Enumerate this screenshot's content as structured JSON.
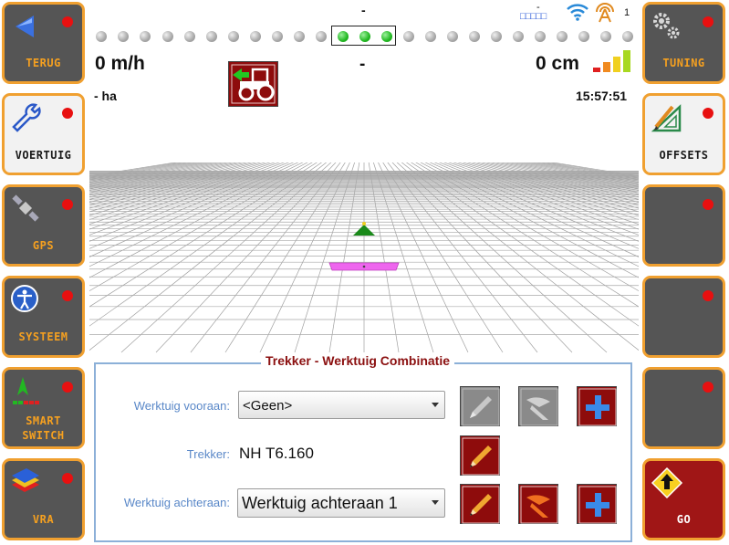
{
  "left_buttons": [
    {
      "label": "TERUG",
      "icon": "back-arrow-icon"
    },
    {
      "label": "VOERTUIG",
      "icon": "wrench-icon"
    },
    {
      "label": "GPS",
      "icon": "satellite-icon"
    },
    {
      "label": "SYSTEEM",
      "icon": "accessibility-icon"
    },
    {
      "label_line1": "SMART",
      "label_line2": "SWITCH",
      "icon": "smart-switch-icon"
    },
    {
      "label": "VRA",
      "icon": "vra-layers-icon"
    }
  ],
  "right_buttons": [
    {
      "label": "TUNING",
      "icon": "gears-icon"
    },
    {
      "label": "OFFSETS",
      "icon": "pencil-triangle-icon"
    },
    {
      "label": ""
    },
    {
      "label": ""
    },
    {
      "label": ""
    },
    {
      "label": "GO",
      "icon": "go-arrow-icon"
    }
  ],
  "status_bar": {
    "top_dash": "-",
    "speed": "0 m/h",
    "center_value": "-",
    "offset": "0 cm",
    "area": "- ha",
    "time": "15:57:51",
    "corr_dash": "-",
    "corr_boxes": "□□□□□",
    "satellites": "1",
    "lightbar_active_count": 3,
    "lightbar_total": 25
  },
  "panel": {
    "title": "Trekker - Werktuig Combinatie",
    "front_label": "Werktuig vooraan:",
    "front_value": "<Geen>",
    "tractor_label": "Trekker:",
    "tractor_value": "NH T6.160",
    "rear_label": "Werktuig achteraan:",
    "rear_value": "Werktuig achteraan 1"
  },
  "colors": {
    "accent_orange": "#f0a030",
    "button_grey": "#555555",
    "alert_red": "#e81010",
    "panel_title_red": "#8b1010",
    "label_blue": "#5a88c8",
    "implement_magenta": "#ee66ee"
  }
}
